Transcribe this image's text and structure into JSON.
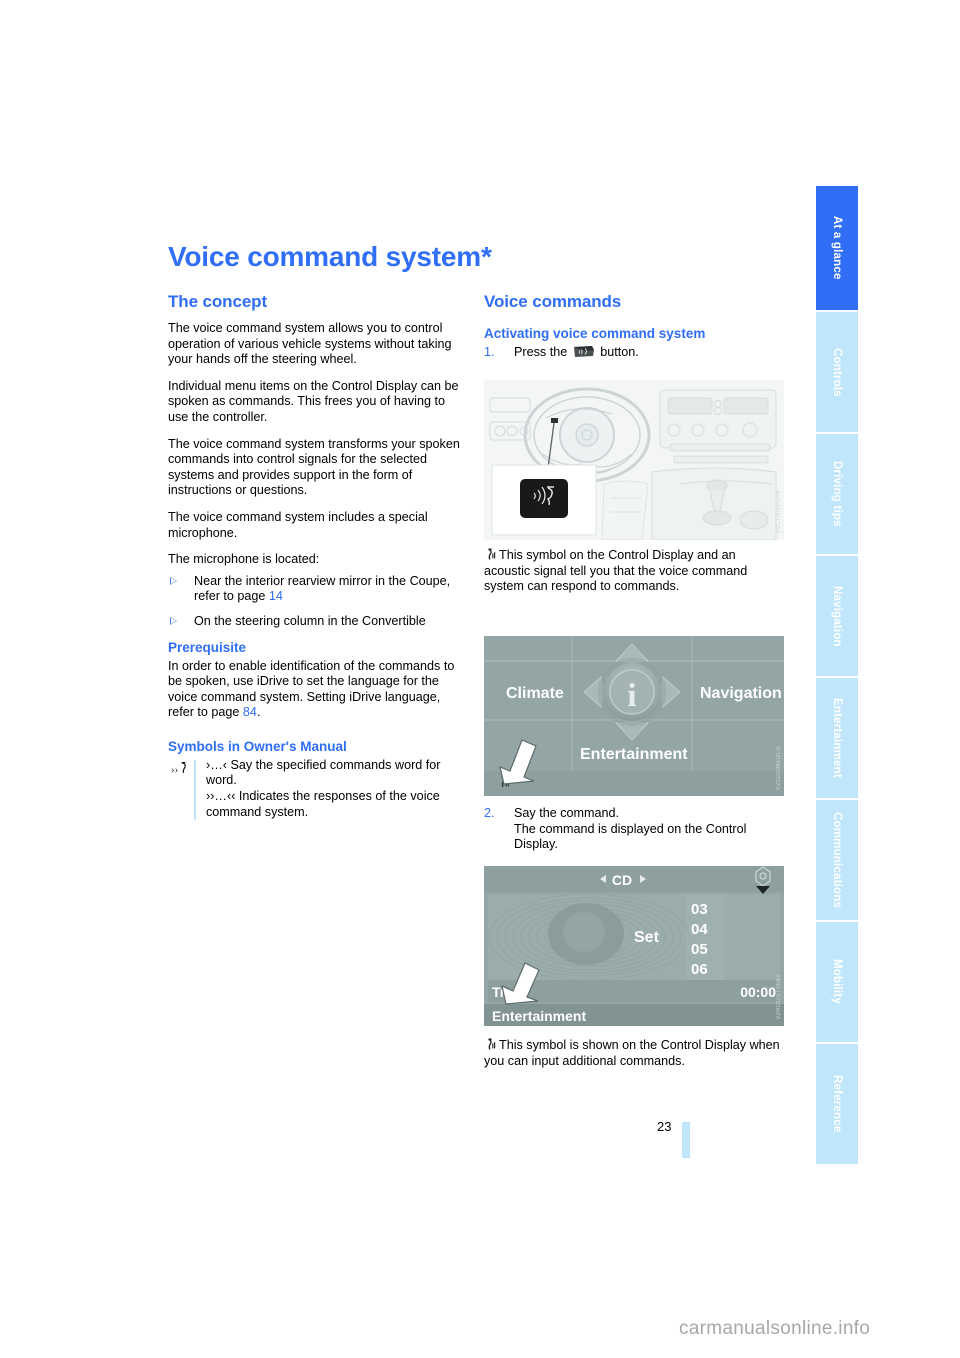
{
  "page_title": "Voice command system*",
  "left_column": {
    "section_heading": "The concept",
    "paragraphs": [
      "The voice command system allows you to control operation of various vehicle systems without taking your hands off the steering wheel.",
      "Individual menu items on the Control Display can be spoken as commands. This frees you of having to use the controller.",
      "The voice command system transforms your spoken commands into control signals for the selected systems and provides support in the form of instructions or questions.",
      "The voice command system includes a special microphone.",
      "The microphone is located:"
    ],
    "bullets": [
      {
        "text": "Near the interior rearview mirror in the Coupe, refer to page ",
        "page_ref": "14"
      },
      {
        "text": "On the steering column in the Convertible",
        "page_ref": ""
      }
    ],
    "prerequisite": {
      "heading": "Prerequisite",
      "text_before": "In order to enable identification of the commands to be spoken, use iDrive to set the language for the voice command system. Setting iDrive language, refer to page ",
      "page_ref": "84",
      "text_after": "."
    },
    "symbols": {
      "heading": "Symbols in Owner's Manual",
      "icon_name": "speech-quote-icon",
      "line1": "›…‹ Say the specified commands word for word.",
      "line2": "››…‹‹ Indicates the responses of the voice command system."
    }
  },
  "right_column": {
    "section_heading": "Voice commands",
    "subheading": "Activating voice command system",
    "step1": {
      "number": "1.",
      "text_before": "Press the",
      "button_icon_name": "voice-command-button-icon",
      "text_after": "button."
    },
    "figure_button": {
      "alt_name": "steering-wheel-voice-button-illustration",
      "code": "VVCD4NVSH4"
    },
    "caption1": {
      "symbol_name": "voice-active-symbol",
      "text": "This symbol on the Control Display and an acoustic signal tell you that the voice command system can respond to commands."
    },
    "figure_idrive": {
      "alt_name": "idrive-main-menu-screenshot",
      "code": "VZ0DDMEDLS",
      "items": {
        "left": "Climate",
        "right": "Navigation",
        "bottom": "Entertainment",
        "center_icon": "info-icon",
        "status_symbol": "voice-active-symbol"
      }
    },
    "step2": {
      "number": "2.",
      "line1": "Say the command.",
      "line2": "The command is displayed on the Control Display."
    },
    "figure_cd": {
      "alt_name": "cd-entertainment-screen-screenshot",
      "code": "V2RDDST0661",
      "title": "CD",
      "arrow_left": "◂",
      "arrow_right": "▸",
      "center_label": "Set",
      "track_list": [
        "03",
        "04",
        "05",
        "06"
      ],
      "track_label": "Tr",
      "time": "00:00",
      "footer": "Entertainment"
    },
    "caption2": {
      "symbol_name": "voice-active-symbol",
      "text": "This symbol is shown on the Control Display when you can input additional commands."
    }
  },
  "side_tabs": [
    {
      "label": "At a glance",
      "active": true
    },
    {
      "label": "Controls",
      "active": false
    },
    {
      "label": "Driving tips",
      "active": false
    },
    {
      "label": "Navigation",
      "active": false
    },
    {
      "label": "Entertainment",
      "active": false
    },
    {
      "label": "Communications",
      "active": false
    },
    {
      "label": "Mobility",
      "active": false
    },
    {
      "label": "Reference",
      "active": false
    }
  ],
  "footer": {
    "page_number": "23",
    "watermark": "carmanualsonline.info"
  },
  "colors": {
    "accent_blue": "#2f6ef5",
    "tab_blue": "#bfe6fb",
    "text": "#000000"
  }
}
